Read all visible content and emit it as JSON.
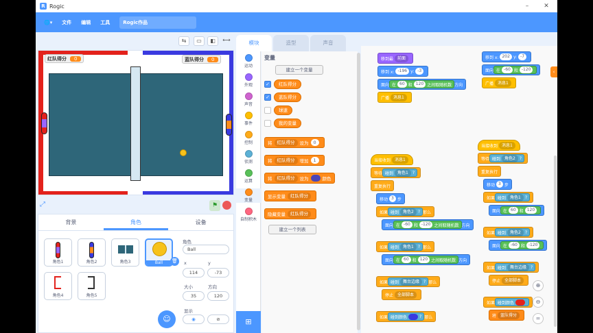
{
  "window": {
    "title": "Rogic",
    "logo_letter": "R",
    "min": "–",
    "max": "□",
    "close": "✕"
  },
  "menu": {
    "globe": "🌐▾",
    "file": "文件",
    "edit": "编辑",
    "tools": "工具",
    "project_name": "Rogic作品"
  },
  "stage": {
    "red_score_label": "红队得分",
    "red_score": "0",
    "blue_score_label": "蓝队得分",
    "blue_score": "0"
  },
  "panel": {
    "tabs": [
      "背景",
      "角色",
      "设备"
    ],
    "sprites": [
      "角色1",
      "角色2",
      "角色3",
      "Ball",
      "角色4",
      "角色5"
    ],
    "sprite_label": "角色",
    "name_value": "Ball",
    "x_label": "x",
    "x_value": "114",
    "y_label": "y",
    "y_value": "-73",
    "size_label": "大小",
    "size_value": "35",
    "dir_label": "方向",
    "dir_value": "120",
    "show_label": "显示"
  },
  "editor": {
    "tabs": [
      "模块",
      "造型",
      "声音"
    ],
    "categories": [
      "运动",
      "外观",
      "声音",
      "事件",
      "控制",
      "侦测",
      "运算",
      "变量",
      "自制积木"
    ],
    "category_colors": [
      "#4c97ff",
      "#9966ff",
      "#cf63cf",
      "#ffbf00",
      "#ffab19",
      "#5cb1d6",
      "#59c059",
      "#ff8c1a",
      "#ff6680"
    ],
    "section_title": "变量",
    "make_var": "建立一个变量",
    "vars": [
      "红队得分",
      "蓝队得分",
      "球速",
      "我的变量"
    ],
    "blocks": {
      "set": "将",
      "to": "设为",
      "change": "增加",
      "by": "",
      "var_red": "红队得分",
      "set_value": "0",
      "change_value": "1",
      "set_color": "颜色",
      "show_var": "显示变量",
      "hide_var": "隐藏变量"
    },
    "make_list": "建立一个列表"
  },
  "scripts": {
    "goto_front": "移到最",
    "front": "前面",
    "move_to": "移到 x:",
    "neg196": "-196",
    "y": "y:",
    "neg3": "-3",
    "point_in": "面向",
    "between": "在",
    "v60": "60",
    "and": "和",
    "v120": "120",
    "pick_random": "之间取随机数",
    "direction": "方向",
    "broadcast": "广播",
    "msg1": "消息1",
    "move_to2": "移到 x:",
    "v202": "202",
    "neg7": "-7",
    "neg60": "-60",
    "neg120": "-120",
    "when_receive": "当接收到",
    "wait_until": "等待",
    "touching": "碰到",
    "sprite1": "角色1",
    "sprite2": "角色2",
    "q": "?",
    "forever": "重复执行",
    "move": "移动",
    "v3": "3",
    "steps": "步",
    "if": "如果",
    "then": "那么",
    "edge": "舞台边缘",
    "stop": "停止",
    "all": "全部脚本",
    "touching_color": "碰到颜色",
    "set_to": "将",
    "var_blue": "蓝队得分",
    "v01": "0.1"
  }
}
